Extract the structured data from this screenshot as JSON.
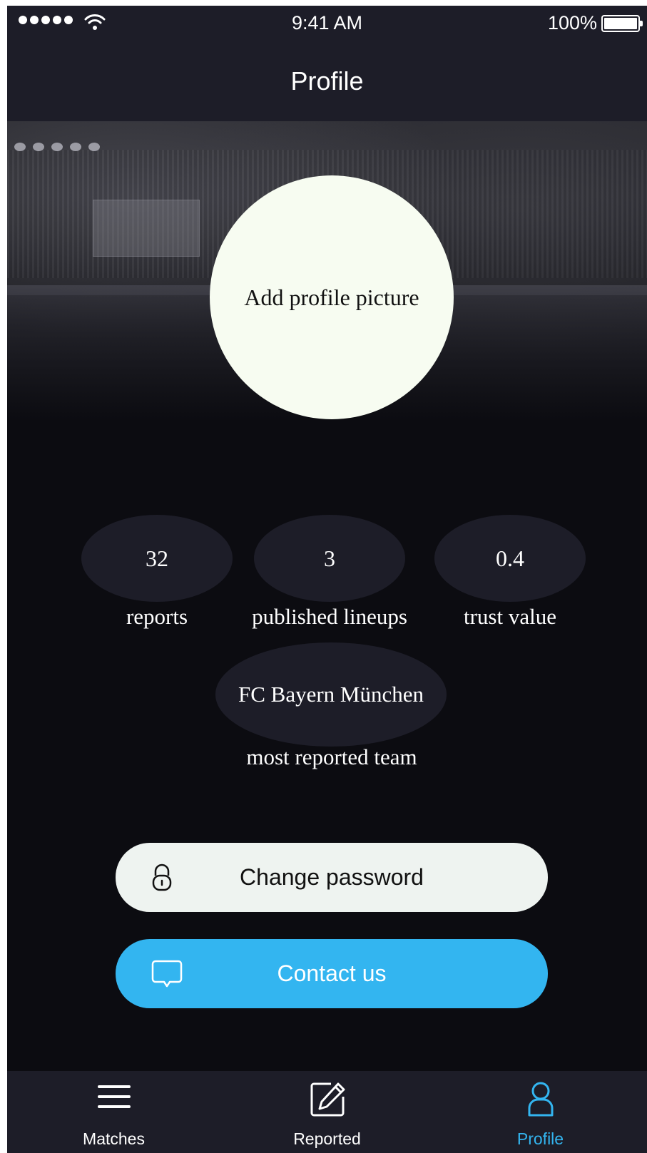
{
  "status_bar": {
    "time": "9:41 AM",
    "battery": "100%",
    "signal_icon": "signal-dots-icon",
    "wifi_icon": "wifi-icon",
    "battery_icon": "battery-full-icon"
  },
  "nav": {
    "title": "Profile"
  },
  "profile": {
    "avatar_label": "Add profile picture"
  },
  "stats": [
    {
      "value": "32",
      "label": "reports"
    },
    {
      "value": "3",
      "label": "published lineups"
    },
    {
      "value": "0.4",
      "label": "trust value"
    }
  ],
  "team": {
    "name": "FC Bayern München",
    "label": "most reported team"
  },
  "buttons": {
    "change_password": {
      "label": "Change password",
      "icon": "lock-icon"
    },
    "contact_us": {
      "label": "Contact us",
      "icon": "chat-bubble-icon"
    }
  },
  "tabs": [
    {
      "label": "Matches",
      "icon": "menu-icon"
    },
    {
      "label": "Reported",
      "icon": "edit-icon"
    },
    {
      "label": "Profile",
      "icon": "profile-icon",
      "active": true
    }
  ],
  "colors": {
    "accent": "#33b5f0",
    "bar_background": "#1d1d28",
    "page_background": "#0c0c11",
    "avatar_background": "#f7fcf1",
    "secondary_button": "#eef3f0"
  }
}
